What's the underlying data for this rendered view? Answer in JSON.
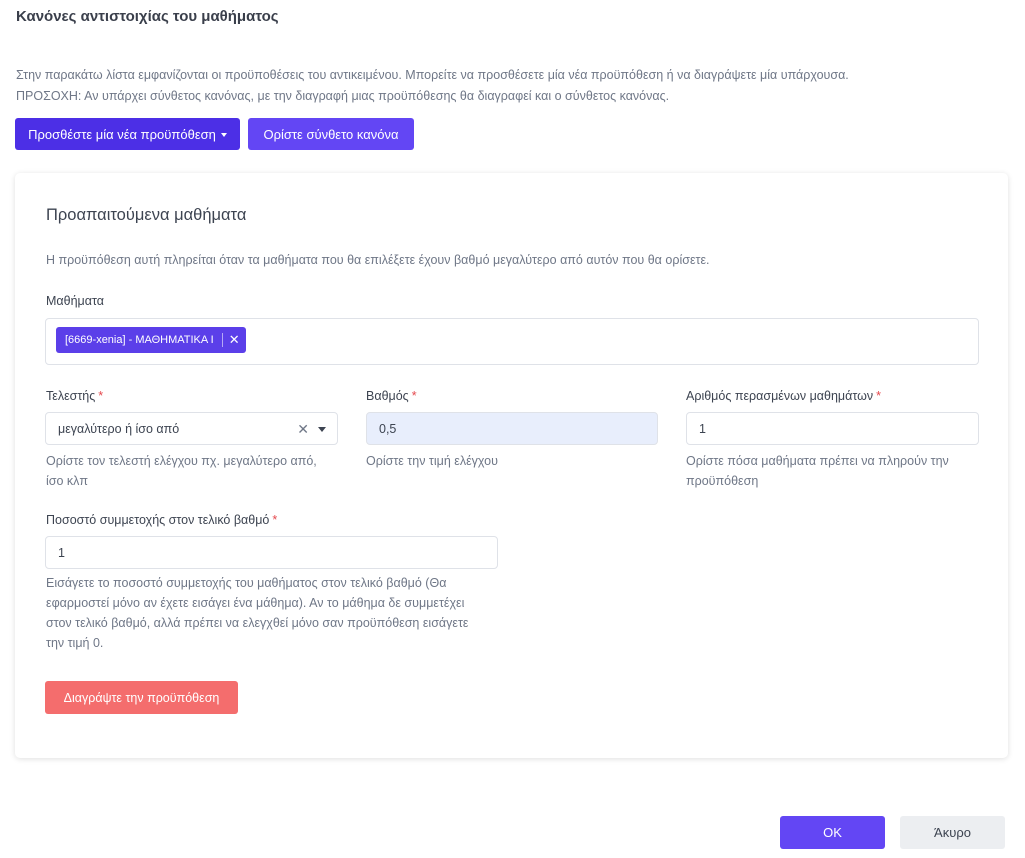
{
  "page": {
    "title": "Κανόνες αντιστοιχίας του μαθήματος",
    "intro_line1": "Στην παρακάτω λίστα εμφανίζονται οι προϋποθέσεις του αντικειμένου. Μπορείτε να προσθέσετε μία νέα προϋπόθεση ή να διαγράψετε μία υπάρχουσα.",
    "intro_line2": "ΠΡΟΣΟΧΗ: Αν υπάρχει σύνθετος κανόνας, με την διαγραφή μιας προϋπόθεσης θα διαγραφεί και ο σύνθετος κανόνας."
  },
  "toolbar": {
    "add_condition_label": "Προσθέστε μία νέα προϋπόθεση",
    "composite_rule_label": "Ορίστε σύνθετο κανόνα"
  },
  "condition": {
    "title": "Προαπαιτούμενα μαθήματα",
    "description": "Η προϋπόθεση αυτή πληρείται όταν τα μαθήματα που θα επιλέξετε έχουν βαθμό μεγαλύτερο από αυτόν που θα ορίσετε.",
    "courses": {
      "label": "Μαθήματα",
      "selected": [
        "[6669-xenia] - ΜΑΘΗΜΑΤΙΚΑ Ι"
      ]
    },
    "operator": {
      "label": "Τελεστής",
      "required_mark": "*",
      "value": "μεγαλύτερο ή ίσο από",
      "help_line1": "Ορίστε τον τελεστή ελέγχου πχ. μεγαλύτερο από,",
      "help_line2": "ίσο κλπ"
    },
    "grade": {
      "label": "Βαθμός",
      "required_mark": "*",
      "value": "0,5",
      "help": "Ορίστε την τιμή ελέγχου"
    },
    "passed_courses": {
      "label": "Αριθμός περασμένων μαθημάτων",
      "required_mark": "*",
      "value": "1",
      "help_line1": "Ορίστε πόσα μαθήματα πρέπει να πληρούν την",
      "help_line2": "προϋπόθεση"
    },
    "participation": {
      "label": "Ποσοστό συμμετοχής στον τελικό βαθμό",
      "required_mark": "*",
      "value": "1",
      "help_line1": "Εισάγετε το ποσοστό συμμετοχής του μαθήματος στον τελικό βαθμό (Θα",
      "help_line2": "εφαρμοστεί μόνο αν έχετε εισάγει ένα μάθημα). Αν το μάθημα δε συμμετέχει",
      "help_line3": "στον τελικό βαθμό, αλλά πρέπει να ελεγχθεί μόνο σαν προϋπόθεση εισάγετε",
      "help_line4": "την τιμή 0."
    },
    "delete_label": "Διαγράψτε την προϋπόθεση"
  },
  "footer": {
    "ok_label": "OK",
    "cancel_label": "Άκυρο"
  },
  "colors": {
    "primary": "#4c2fe6",
    "secondary": "#6346f4",
    "danger": "#f46d6d",
    "required": "#e5484d"
  },
  "icons": {
    "caret": "caret-down-icon",
    "chip_remove": "close-icon",
    "select_clear": "clear-icon",
    "select_arrow": "chevron-down-icon"
  }
}
